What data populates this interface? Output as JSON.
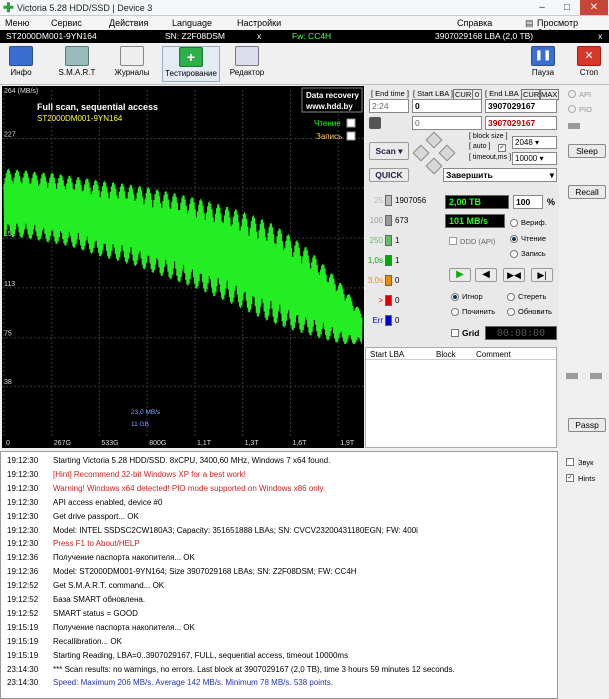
{
  "window": {
    "title": "Victoria 5.28 HDD/SSD | Device 3",
    "minimize": "–",
    "maximize": "□",
    "close": "✕"
  },
  "menu": {
    "items": [
      "Меню",
      "Сервис",
      "Действия",
      "Language",
      "Настройки"
    ],
    "help": "Справка",
    "clipboard": "Просмотр буфера"
  },
  "device": {
    "model": "ST2000DM001-9YN164",
    "serial": "SN: Z2F08DSM",
    "close": "x",
    "firmware": "Fw: CC4H",
    "capacity": "3907029168 LBA (2,0 TB)",
    "x_right": "x"
  },
  "toolbar": {
    "info": "Инфо",
    "smart": "S.M.A.R.T",
    "logs": "Журналы",
    "testing": "Тестирование",
    "editor": "Редактор",
    "pause": "Пауза",
    "stop": "Стоп"
  },
  "graph": {
    "ymax": "264 (MB/s)",
    "yticks": [
      "227",
      "189",
      "151",
      "113",
      "75",
      "38"
    ],
    "xticks": [
      "0",
      "267G",
      "533G",
      "800G",
      "1,1T",
      "1,3T",
      "1,6T",
      "1,9T"
    ],
    "title": "Full scan, sequential access",
    "model": "ST2000DM001-9YN164",
    "logo_line1": "Data recovery",
    "logo_line2": "www.hdd.by",
    "read_label": "Чтение",
    "write_label": "Запись",
    "speed_readout": "23,0 MB/s",
    "size_readout": "11 GB"
  },
  "chart_data": {
    "type": "line",
    "title": "Full scan, sequential access",
    "xlabel": "",
    "ylabel": "",
    "y_unit": "MB/s",
    "ylim": [
      0,
      264
    ],
    "x_categories": [
      "0",
      "267G",
      "533G",
      "800G",
      "1,1T",
      "1,3T",
      "1,6T",
      "1,9T"
    ],
    "series": [
      {
        "color": "#22ee22",
        "x_gb": [
          0,
          100,
          200,
          267,
          350,
          450,
          533,
          650,
          750,
          800,
          900,
          1000,
          1100,
          1200,
          1300,
          1400,
          1500,
          1600,
          1700,
          1800,
          1900,
          2000
        ],
        "y_center": [
          178,
          177,
          175,
          174,
          172,
          169,
          166,
          163,
          160,
          158,
          154,
          150,
          146,
          141,
          136,
          130,
          124,
          117,
          110,
          101,
          92,
          82
        ],
        "y_amplitude": [
          26,
          26,
          26,
          27,
          27,
          28,
          29,
          30,
          31,
          32,
          33,
          34,
          35,
          36,
          37,
          38,
          38,
          36,
          33,
          28,
          22,
          12
        ]
      }
    ]
  },
  "controls": {
    "end_time_label": "[ End time ]",
    "start_lba_label": "[ Start LBA ]",
    "cur_label": "CUR",
    "zero_label": "0",
    "end_lba_label": "[ End LBA ]",
    "cur2_label": "CUR",
    "max_label": "MAX",
    "end_time": "2:24",
    "start_lba": "0",
    "end_lba": "3907029167",
    "second_start": "0",
    "second_end": "3907029167",
    "block_size_label": "[ block size ]",
    "auto_label": "[ auto ]",
    "timeout_label": "[ timeout,ms ]",
    "block_size": "2048",
    "timeout": "10000",
    "scan_btn": "Scan",
    "quick_btn": "QUICK",
    "finish_select": "Завершить",
    "counters": [
      {
        "label": "25",
        "value": "1907056",
        "color": "#bbbbbb"
      },
      {
        "label": "100",
        "value": "673",
        "color": "#9a9a9a"
      },
      {
        "label": "250",
        "value": "1",
        "color": "#66bb66"
      },
      {
        "label": "1,0s",
        "value": "1",
        "color": "#00aa00"
      },
      {
        "label": "3,0s",
        "value": "0",
        "color": "#ee8800"
      },
      {
        "label": ">",
        "value": "0",
        "color": "#dd0000"
      },
      {
        "label": "Err",
        "value": "0",
        "color": "#0000cc"
      }
    ],
    "progress_size": "2,00 TB",
    "progress_pct": "100",
    "pct_sign": "%",
    "speed": "101 MB/s",
    "ddd_label": "DDD (API)",
    "verify_label": "Вериф.",
    "read_label": "Чтение",
    "write_label": "Запись",
    "ignore_label": "Игнор",
    "erase_label": "Стереть",
    "repair_label": "Починить",
    "update_label": "Обновить",
    "grid_label": "Grid",
    "timer": "00:00:00",
    "table_start": "Start LBA",
    "table_block": "Block",
    "table_comment": "Comment"
  },
  "right": {
    "api": "API",
    "pio": "PIO",
    "sleep": "Sleep",
    "recall": "Recall",
    "passp": "Passp",
    "sound": "Звук",
    "hints": "Hints"
  },
  "log": [
    {
      "time": "19:12:30",
      "text": "Starting Victoria 5.28 HDD/SSD. 8xCPU, 3400,60 MHz, Windows 7 x64 found.",
      "color": "#000000"
    },
    {
      "time": "19:12:30",
      "text": "[Hint] Recommend 32-bit Windows XP for a best work!",
      "color": "#cc2222"
    },
    {
      "time": "19:12:30",
      "text": "Warning! Windows x64 detected! PIO mode supported on Windows x86 only.",
      "color": "#cc2222"
    },
    {
      "time": "19:12:30",
      "text": "API access enabled, device #0",
      "color": "#000000"
    },
    {
      "time": "19:12:30",
      "text": "Get drive passport... OK",
      "color": "#000000"
    },
    {
      "time": "19:12:30",
      "text": "Model: INTEL SSDSC2CW180A3; Capacity: 351651888 LBAs; SN: CVCV23200431180EGN; FW: 400i",
      "color": "#000000"
    },
    {
      "time": "19:12:30",
      "text": "Press F1 to About/HELP",
      "color": "#cc2222"
    },
    {
      "time": "19:12:36",
      "text": "Получение паспорта накопителя... OK",
      "color": "#000000"
    },
    {
      "time": "19:12:36",
      "text": "Model: ST2000DM001-9YN164; Size 3907029168 LBAs; SN: Z2F08DSM; FW: CC4H",
      "color": "#000000"
    },
    {
      "time": "19:12:52",
      "text": "Get S.M.A.R.T. command... OK",
      "color": "#000000"
    },
    {
      "time": "19:12:52",
      "text": "База SMART обновлена.",
      "color": "#000000"
    },
    {
      "time": "19:12:52",
      "text": "SMART status = GOOD",
      "color": "#000000"
    },
    {
      "time": "19:15:19",
      "text": "Получение паспорта накопителя... OK",
      "color": "#000000"
    },
    {
      "time": "19:15:19",
      "text": "Recallibration... OK",
      "color": "#000000"
    },
    {
      "time": "19:15:19",
      "text": "Starting Reading, LBA=0..3907029167, FULL, sequential access, timeout 10000ms",
      "color": "#000000"
    },
    {
      "time": "23:14:30",
      "text": "*** Scan results: no warnings, no errors. Last block at 3907029167 (2,0 TB), time 3 hours 59 minutes 12 seconds.",
      "color": "#000000"
    },
    {
      "time": "23:14:30",
      "text": "Speed: Maximum 206 MB/s. Average 142 MB/s. Minimum 78 MB/s. 538 points.",
      "color": "#2233bb"
    }
  ]
}
